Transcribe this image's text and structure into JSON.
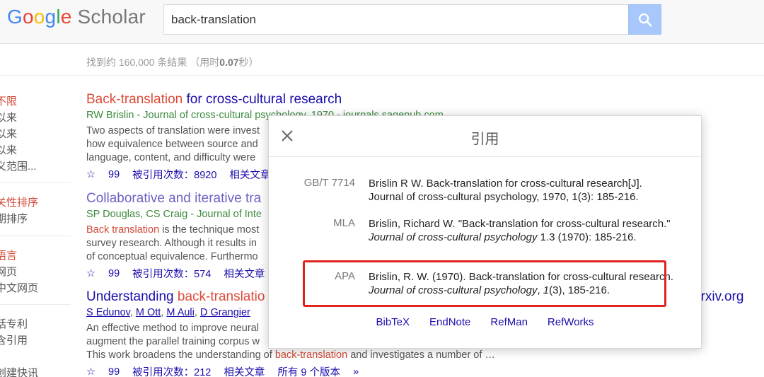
{
  "header": {
    "logo_parts": [
      "G",
      "o",
      "o",
      "g",
      "l",
      "e"
    ],
    "logo_scholar": "Scholar",
    "search_value": "back-translation"
  },
  "results_meta": {
    "count_prefix": "找到约 160,000 条结果 （用时",
    "count_time": "0.07",
    "count_suffix": "秒）"
  },
  "sidebar": {
    "items": [
      "不限",
      "以来",
      "以来",
      "以来",
      "义范围...",
      "关性排序",
      "期排序",
      "语言",
      "网页",
      "中文网页",
      "括专利",
      "含引用",
      "创建快讯"
    ]
  },
  "results": [
    {
      "title_hl": "Back-translation",
      "title_rest": " for cross-cultural research",
      "meta": "RW Brislin - Journal of cross-cultural psychology, 1970 - journals.sagepub.com",
      "snippets": [
        "Two aspects of translation were invest",
        "how equivalence between source and",
        "language, content, and difficulty were"
      ],
      "actions": [
        "☆",
        "99",
        "被引用次数：8920",
        "相关文章"
      ]
    },
    {
      "title": "Collaborative and iterative tra",
      "meta": "SP Douglas, CS Craig - Journal of Inte",
      "snippet_hl": "Back translation",
      "snippet_rest": " is the technique most",
      "snippets": [
        "survey research. Although it results in",
        "of conceptual equivalence. Furthermo"
      ],
      "actions": [
        "☆",
        "99",
        "被引用次数：574",
        "相关文章"
      ]
    },
    {
      "title_pre": "Understanding ",
      "title_hl": "back-translatio",
      "authors": [
        "S Edunov",
        "M Ott",
        "M Auli",
        "D Grangier"
      ],
      "source": "arxiv.org",
      "snippets": [
        "An effective method to improve neural",
        "augment the parallel training corpus w"
      ],
      "last_snip_pre": "This work broadens the understanding of ",
      "last_snip_hl": "back-translation",
      "last_snip_rest": " and investigates a number of …",
      "actions": [
        "☆",
        "99",
        "被引用次数：212",
        "相关文章",
        "所有 9 个版本"
      ]
    }
  ],
  "cite_modal": {
    "title": "引用",
    "rows": [
      {
        "style": "GB/T 7714",
        "text": "Brislin R W. Back-translation for cross-cultural research[J]. Journal of cross-cultural psychology, 1970, 1(3): 185-216."
      },
      {
        "style": "MLA",
        "text_pre": "Brislin, Richard W. \"Back-translation for cross-cultural research.\" ",
        "text_it": "Journal of cross-cultural psychology",
        "text_post": " 1.3 (1970): 185-216."
      },
      {
        "style": "APA",
        "text_pre": "Brislin, R. W. (1970). Back-translation for cross-cultural research. ",
        "text_it": "Journal of cross-cultural psychology",
        "text_mid": ", ",
        "text_it2": "1",
        "text_post": "(3), 185-216."
      }
    ],
    "export_links": [
      "BibTeX",
      "EndNote",
      "RefMan",
      "RefWorks"
    ]
  },
  "colors": {
    "link": "#1a0dab",
    "highlight": "#dd4b39",
    "apa_box": "#e0231c",
    "search_button": "#a8c7fa"
  }
}
